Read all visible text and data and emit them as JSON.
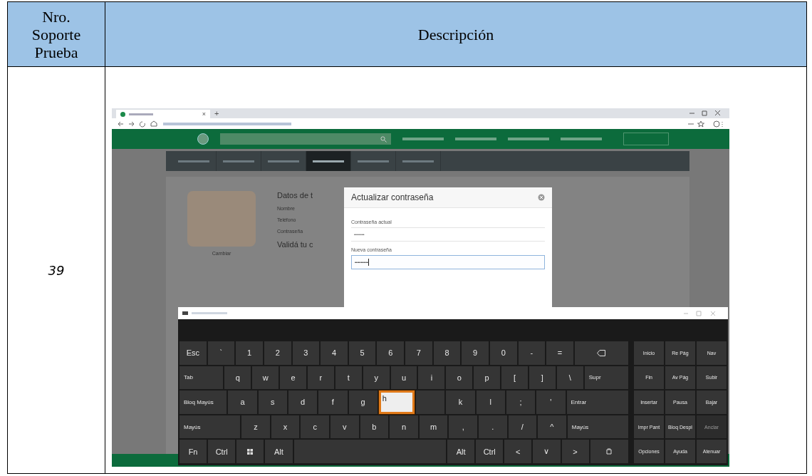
{
  "table": {
    "header": [
      "Nro.\nSoporte\nPrueba",
      "Descripción"
    ],
    "rows": [
      {
        "number": "39",
        "screenshot": {
          "browser": {
            "tab_close": "×",
            "new_tab": "+"
          },
          "subnav": [
            {
              "selected": false
            },
            {
              "selected": false
            },
            {
              "selected": false
            },
            {
              "selected": true
            },
            {
              "selected": false
            },
            {
              "selected": false
            }
          ],
          "profile": {
            "heading": "Datos de t",
            "labels": [
              "Nombre",
              "Teléfono",
              "Contraseña"
            ],
            "caption": "Cambiar",
            "subheading": "Validá tu c"
          },
          "modal": {
            "title": "Actualizar contraseña",
            "fields": [
              {
                "label": "Contraseña actual",
                "value": "•••••••",
                "focused": false
              },
              {
                "label": "Nueva contraseña",
                "value": "•••••••••",
                "focused": true
              }
            ]
          },
          "keyboard": {
            "main": [
              [
                {
                  "kind": "key",
                  "label": "Esc",
                  "focused": false
                },
                {
                  "kind": "key",
                  "label": "`",
                  "focused": false
                },
                {
                  "kind": "key",
                  "label": "1",
                  "focused": false
                },
                {
                  "kind": "key",
                  "label": "2",
                  "focused": false
                },
                {
                  "kind": "key",
                  "label": "3",
                  "focused": false
                },
                {
                  "kind": "key",
                  "label": "4",
                  "focused": false
                },
                {
                  "kind": "key",
                  "label": "5",
                  "focused": false
                },
                {
                  "kind": "key",
                  "label": "6",
                  "focused": false
                },
                {
                  "kind": "key",
                  "label": "7",
                  "focused": false
                },
                {
                  "kind": "key",
                  "label": "8",
                  "focused": false
                },
                {
                  "kind": "key",
                  "label": "9",
                  "focused": false
                },
                {
                  "kind": "key",
                  "label": "0",
                  "focused": false
                },
                {
                  "kind": "key",
                  "label": "-",
                  "focused": false
                },
                {
                  "kind": "key",
                  "label": "=",
                  "focused": false
                },
                {
                  "kind": "backspace",
                  "focused": false
                }
              ],
              [
                {
                  "kind": "wide",
                  "label": "Tab",
                  "focused": false
                },
                {
                  "kind": "key",
                  "label": "q",
                  "focused": false
                },
                {
                  "kind": "key",
                  "label": "w",
                  "focused": false
                },
                {
                  "kind": "key",
                  "label": "e",
                  "focused": false
                },
                {
                  "kind": "key",
                  "label": "r",
                  "focused": false
                },
                {
                  "kind": "key",
                  "label": "t",
                  "focused": false
                },
                {
                  "kind": "key",
                  "label": "y",
                  "focused": false
                },
                {
                  "kind": "key",
                  "label": "u",
                  "focused": false
                },
                {
                  "kind": "key",
                  "label": "i",
                  "focused": false
                },
                {
                  "kind": "key",
                  "label": "o",
                  "focused": false
                },
                {
                  "kind": "key",
                  "label": "p",
                  "focused": false
                },
                {
                  "kind": "key",
                  "label": "[",
                  "focused": false
                },
                {
                  "kind": "key",
                  "label": "]",
                  "focused": false
                },
                {
                  "kind": "key",
                  "label": "\\",
                  "focused": false
                },
                {
                  "kind": "wide",
                  "label": "Supr",
                  "focused": false
                }
              ],
              [
                {
                  "kind": "wide",
                  "label": "Bloq Mayús",
                  "focused": false
                },
                {
                  "kind": "key",
                  "label": "a",
                  "focused": false
                },
                {
                  "kind": "key",
                  "label": "s",
                  "focused": false
                },
                {
                  "kind": "key",
                  "label": "d",
                  "focused": false
                },
                {
                  "kind": "key",
                  "label": "f",
                  "focused": false
                },
                {
                  "kind": "key",
                  "label": "g",
                  "focused": false
                },
                {
                  "kind": "key",
                  "label": "h",
                  "focused": true
                },
                {
                  "kind": "blank",
                  "focused": false
                },
                {
                  "kind": "key",
                  "label": "k",
                  "focused": false
                },
                {
                  "kind": "key",
                  "label": "l",
                  "focused": false
                },
                {
                  "kind": "key",
                  "label": ";",
                  "focused": false
                },
                {
                  "kind": "key",
                  "label": "'",
                  "focused": false
                },
                {
                  "kind": "wider",
                  "label": "Entrar",
                  "focused": false
                }
              ],
              [
                {
                  "kind": "wider",
                  "label": "Mayús",
                  "focused": false
                },
                {
                  "kind": "key",
                  "label": "z",
                  "focused": false
                },
                {
                  "kind": "key",
                  "label": "x",
                  "focused": false
                },
                {
                  "kind": "key",
                  "label": "c",
                  "focused": false
                },
                {
                  "kind": "key",
                  "label": "v",
                  "focused": false
                },
                {
                  "kind": "key",
                  "label": "b",
                  "focused": false
                },
                {
                  "kind": "key",
                  "label": "n",
                  "focused": false
                },
                {
                  "kind": "key",
                  "label": "m",
                  "focused": false
                },
                {
                  "kind": "key",
                  "label": ",",
                  "focused": false
                },
                {
                  "kind": "key",
                  "label": ".",
                  "focused": false
                },
                {
                  "kind": "key",
                  "label": "/",
                  "focused": false
                },
                {
                  "kind": "key",
                  "label": "^",
                  "focused": false
                },
                {
                  "kind": "wider",
                  "label": "Mayús",
                  "focused": false
                }
              ],
              [
                {
                  "kind": "key",
                  "label": "Fn",
                  "focused": false
                },
                {
                  "kind": "key",
                  "label": "Ctrl",
                  "focused": false
                },
                {
                  "kind": "windows",
                  "focused": false
                },
                {
                  "kind": "key",
                  "label": "Alt",
                  "focused": false
                },
                {
                  "kind": "space",
                  "focused": false
                },
                {
                  "kind": "key",
                  "label": "Alt",
                  "focused": false
                },
                {
                  "kind": "key",
                  "label": "Ctrl",
                  "focused": false
                },
                {
                  "kind": "key",
                  "label": "<",
                  "focused": false
                },
                {
                  "kind": "key",
                  "label": "∨",
                  "focused": false
                },
                {
                  "kind": "key",
                  "label": ">",
                  "focused": false
                },
                {
                  "kind": "keyboard-icon",
                  "focused": false
                }
              ]
            ],
            "nav": [
              [
                {
                  "label": "Inicio",
                  "disabled": false
                },
                {
                  "label": "Re Pág",
                  "disabled": false
                },
                {
                  "label": "Nav",
                  "disabled": false
                }
              ],
              [
                {
                  "label": "Fin",
                  "disabled": false
                },
                {
                  "label": "Av Pág",
                  "disabled": false
                },
                {
                  "label": "Subir",
                  "disabled": false
                }
              ],
              [
                {
                  "label": "Insertar",
                  "disabled": false
                },
                {
                  "label": "Pausa",
                  "disabled": false
                },
                {
                  "label": "Bajar",
                  "disabled": false
                }
              ],
              [
                {
                  "label": "Impr Pant",
                  "disabled": false
                },
                {
                  "label": "Bloq Despl",
                  "disabled": false
                },
                {
                  "label": "Anclar",
                  "disabled": true
                }
              ],
              [
                {
                  "label": "Opciones",
                  "disabled": false
                },
                {
                  "label": "Ayuda",
                  "disabled": false
                },
                {
                  "label": "Atenuar",
                  "disabled": false
                }
              ]
            ]
          }
        }
      }
    ]
  }
}
